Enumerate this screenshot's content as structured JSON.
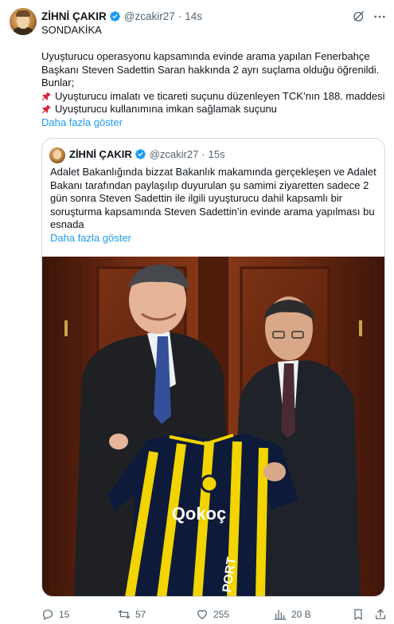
{
  "author": {
    "name": "ZİHNİ ÇAKIR",
    "handle": "@zcakir27",
    "separator": "·",
    "time": "14s"
  },
  "post": {
    "lines": [
      "SONDAKİKA",
      "",
      "Uyuşturucu operasyonu kapsamında evinde arama yapılan Fenerbahçe",
      "Başkanı Steven Sadettin Saran hakkında  2 ayrı suçlama olduğu öğrenildi.",
      "Bunlar;"
    ],
    "bullets": [
      "Uyuşturucu imalatı ve ticareti suçunu düzenleyen TCK’nın 188. maddesi",
      "Uyuşturucu kullanımına imkan sağlamak suçunu"
    ],
    "show_more": "Daha fazla göster"
  },
  "quote": {
    "author": {
      "name": "ZİHNİ ÇAKIR",
      "handle": "@zcakir27",
      "separator": "·",
      "time": "15s"
    },
    "lines": [
      "Adalet Bakanlığında bizzat Bakanlık makamında gerçekleşen ve Adalet",
      "Bakanı tarafından paylaşılıp duyurulan şu samimi ziyaretten sadece 2",
      "gün sonra Steven Sadettin ile ilgili uyuşturucu dahil kapsamlı bir",
      "soruşturma kapsamında Steven Sadettin’in evinde arama yapılması bu",
      "esnada"
    ],
    "show_more": "Daha fazla göster",
    "photo": {
      "jersey_sponsor": "Qokoç",
      "jersey_sleeve": "PORT"
    }
  },
  "actions": {
    "replies": "15",
    "reposts": "57",
    "likes": "255",
    "views": "20 B"
  },
  "colors": {
    "link": "#1d9bf0",
    "muted": "#536471",
    "border": "#cfd9de",
    "verified": "#1d9bf0"
  },
  "icons": [
    "verified-badge-icon",
    "grok-icon",
    "more-icon",
    "pushpin-icon",
    "reply-icon",
    "repost-icon",
    "like-icon",
    "views-icon",
    "bookmark-icon",
    "share-icon"
  ]
}
